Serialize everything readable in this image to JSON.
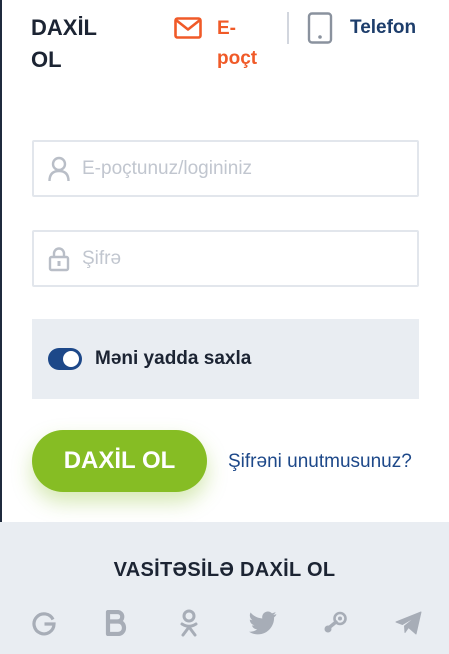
{
  "title": "DAXİL OL",
  "tabs": {
    "email_label": "E-poçt",
    "phone_label": "Telefon"
  },
  "form": {
    "login_placeholder": "E-poçtunuz/logininiz",
    "password_placeholder": "Şifrə",
    "remember_label": "Məni yadda saxla",
    "remember_checked": true,
    "submit_label": "DAXİL OL",
    "forgot_label": "Şifrəni unutmusunuz?"
  },
  "social": {
    "heading": "VASİTƏSİLƏ DAXİL OL",
    "providers": [
      "google-icon",
      "b-icon",
      "odnoklassniki-icon",
      "twitter-icon",
      "steam-icon",
      "telegram-icon"
    ]
  },
  "colors": {
    "accent_orange": "#f05a28",
    "primary_blue": "#1d4889",
    "button_green": "#86bd24",
    "panel_gray": "#e9edf2"
  }
}
